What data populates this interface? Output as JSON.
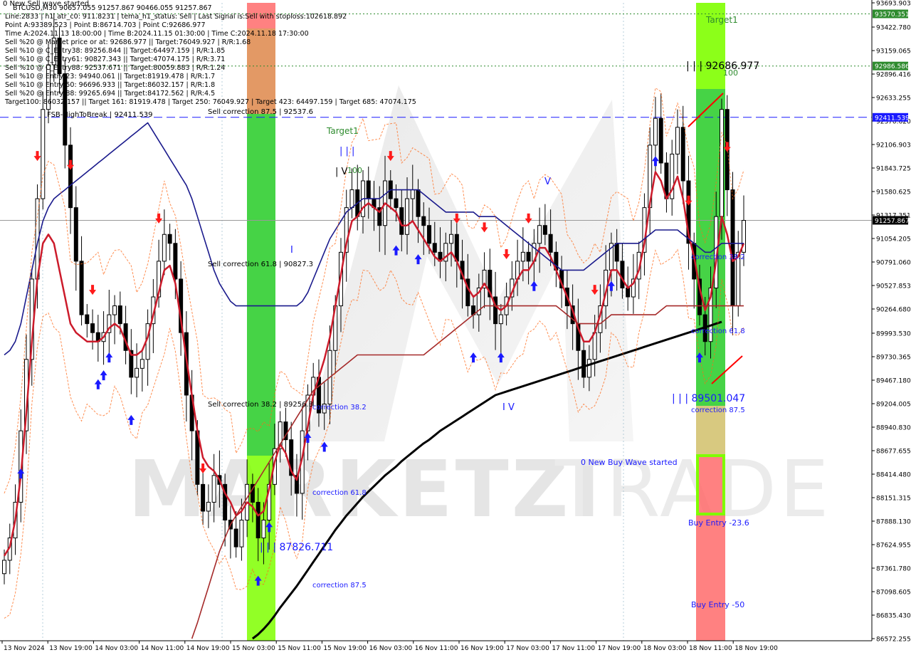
{
  "header": {
    "title": "0 New Sell wave started",
    "lines": [
      "BTCUSD,M30  90657.055 91257.867 90466.055 91257.867",
      "Line:2833 | h1_atr_c0: 911.8231 | tema_h1_status: Sell | Last Signal is:Sell with stoploss:102618.892",
      "Point A:93389.523 | Point B:86714.703 | Point C:92686.977",
      "Time A:2024.11.13 18:00:00 | Time B:2024.11.15 01:30:00 | Time C:2024.11.18 17:30:00",
      "Sell %20 @ Market price or at: 92686.977 || Target:76049.927 | R/R:1.68",
      "Sell %10 @ C_Entry38: 89256.844 || Target:64497.159 | R/R:1.85",
      "Sell %10 @ C_Entry61: 90827.343 || Target:47074.175 | R/R:3.71",
      "Sell %10 @ C_Entry88: 92537.671 || Target:80059.883 | R/R:1.24",
      "Sell %10 @ Entry-23: 94940.061 || Target:81919.478 | R/R:1.7",
      "Sell %10 @ Entry-50: 96696.933 || Target:86032.157 | R/R:1.8",
      "Sell %20 @ Entry-88: 99265.694 || Target:84172.562 | R/R:4.5",
      "Target100: 86032.157 || Target 161: 81919.478 | Target 250: 76049.927 | Target 423: 64497.159 | Target 685: 47074.175"
    ]
  },
  "chart_data": {
    "type": "candlestick",
    "symbol": "BTCUSD",
    "timeframe": "M30",
    "ylim": [
      86572.255,
      93693.903
    ],
    "y_ticks": [
      "93693.903",
      "93422.780",
      "93159.065",
      "92896.416",
      "92633.255",
      "92370.620",
      "92106.903",
      "91843.725",
      "91580.625",
      "91317.351",
      "91054.205",
      "90791.060",
      "90527.853",
      "90264.680",
      "89993.530",
      "89730.365",
      "89467.180",
      "89204.005",
      "88940.830",
      "88677.655",
      "88414.480",
      "88151.315",
      "87888.130",
      "87624.955",
      "87361.780",
      "87098.605",
      "86835.430",
      "86572.255"
    ],
    "x_ticks": [
      "13 Nov 2024",
      "13 Nov 19:00",
      "14 Nov 03:00",
      "14 Nov 11:00",
      "14 Nov 19:00",
      "15 Nov 03:00",
      "15 Nov 11:00",
      "15 Nov 19:00",
      "16 Nov 03:00",
      "16 Nov 11:00",
      "16 Nov 19:00",
      "17 Nov 03:00",
      "17 Nov 11:00",
      "17 Nov 19:00",
      "18 Nov 03:00",
      "18 Nov 11:00",
      "18 Nov 19:00"
    ],
    "current_price": "91257.867",
    "price_lines": [
      {
        "value": 93570.351,
        "label": "93570.351",
        "style": "dotted",
        "color": "#2e8b2e"
      },
      {
        "value": 92986.586,
        "label": "92986.586",
        "style": "dotted",
        "color": "#2e8b2e"
      },
      {
        "value": 92411.539,
        "label": "92411.539",
        "style": "dashed",
        "color": "#1a1aff"
      },
      {
        "value": 91257.867,
        "label": "91257.867",
        "style": "solid",
        "color": "#999999"
      }
    ],
    "annotations": [
      {
        "text": "Target1",
        "color": "#2e8b2e"
      },
      {
        "text": "Target1",
        "color": "#2e8b2e"
      },
      {
        "text": "| | | 92686.977",
        "color": "#000000"
      },
      {
        "text": "100",
        "color": "#2e8b2e"
      },
      {
        "text": "FSB-HighToBreak | 92411.539",
        "color": "#000000"
      },
      {
        "text": "Sell correction 87.5 | 92537.6",
        "color": "#000000"
      },
      {
        "text": "Sell correction 61.8 | 90827.3",
        "color": "#000000"
      },
      {
        "text": "Sell correction 38.2 | 89256.8",
        "color": "#000000"
      },
      {
        "text": "| | |",
        "color": "#1a1aff"
      },
      {
        "text": "| V",
        "color": "#000000"
      },
      {
        "text": "100",
        "color": "#2e8b2e"
      },
      {
        "text": "V",
        "color": "#1a1aff"
      },
      {
        "text": "I V",
        "color": "#1a1aff"
      },
      {
        "text": "I",
        "color": "#1a1aff"
      },
      {
        "text": "correction 38.2",
        "color": "#1a1aff"
      },
      {
        "text": "correction 61.8",
        "color": "#1a1aff"
      },
      {
        "text": "correction 87.5",
        "color": "#1a1aff"
      },
      {
        "text": "| | | 87826.711",
        "color": "#1a1aff"
      },
      {
        "text": "| | | 89501.047",
        "color": "#1a1aff"
      },
      {
        "text": "correction 38.2",
        "color": "#1a1aff"
      },
      {
        "text": "correction 61.8",
        "color": "#1a1aff"
      },
      {
        "text": "correction 87.5",
        "color": "#1a1aff"
      },
      {
        "text": "0 New Buy Wave started",
        "color": "#1a1aff"
      },
      {
        "text": "Buy Entry -23.6",
        "color": "#1a1aff"
      },
      {
        "text": "Buy Entry -50",
        "color": "#1a1aff"
      }
    ],
    "series": [
      {
        "name": "close",
        "color": "#000000",
        "values": [
          87450,
          87700,
          88100,
          88900,
          89700,
          90600,
          91500,
          92500,
          93000,
          93300,
          92900,
          92100,
          91400,
          90800,
          90200,
          90100,
          90000,
          89900,
          90000,
          90200,
          90300,
          90100,
          89800,
          89500,
          89600,
          89700,
          90100,
          90400,
          90800,
          91100,
          91000,
          90600,
          90000,
          89300,
          88900,
          88300,
          88000,
          88100,
          88400,
          88300,
          87900,
          87800,
          87600,
          87900,
          88300,
          88100,
          87700,
          87900,
          88300,
          88700,
          89000,
          88800,
          88400,
          88200,
          88900,
          89300,
          89500,
          89100,
          89200,
          89800,
          90300,
          90900,
          91400,
          91600,
          91300,
          91700,
          91500,
          91400,
          91200,
          91700,
          91500,
          91400,
          91100,
          91500,
          91600,
          91300,
          91200,
          91000,
          90900,
          90800,
          91000,
          91100,
          90800,
          90600,
          90300,
          90200,
          90500,
          90700,
          90400,
          90100,
          90200,
          90400,
          90600,
          90800,
          90900,
          90800,
          91000,
          91200,
          91100,
          90900,
          90700,
          90500,
          90300,
          90100,
          89800,
          89500,
          89700,
          90000,
          90300,
          90700,
          91000,
          90800,
          90500,
          90400,
          90600,
          90900,
          91400,
          92100,
          92400,
          91900,
          91500,
          92000,
          92300,
          91700,
          91000,
          90600,
          90200,
          89900,
          90500,
          91300,
          92500,
          91600,
          90300,
          90900,
          91257
        ]
      },
      {
        "name": "tema",
        "color": "#cc1b2b",
        "values": [
          87500,
          87600,
          87900,
          88400,
          89100,
          89900,
          90600,
          91000,
          91100,
          91000,
          90700,
          90400,
          90100,
          90000,
          89950,
          89900,
          89900,
          89900,
          89950,
          90050,
          90100,
          90050,
          89900,
          89750,
          89750,
          89800,
          89950,
          90200,
          90450,
          90700,
          90750,
          90550,
          90150,
          89700,
          89300,
          88900,
          88600,
          88500,
          88450,
          88350,
          88200,
          88100,
          87950,
          88000,
          88100,
          88050,
          87950,
          88000,
          88250,
          88550,
          88750,
          88650,
          88450,
          88350,
          88600,
          88950,
          89300,
          89500,
          89700,
          89950,
          90300,
          90650,
          91000,
          91250,
          91300,
          91400,
          91450,
          91400,
          91350,
          91450,
          91400,
          91350,
          91200,
          91200,
          91250,
          91150,
          91050,
          90950,
          90850,
          90800,
          90850,
          90900,
          90800,
          90650,
          90500,
          90400,
          90450,
          90550,
          90450,
          90300,
          90250,
          90300,
          90450,
          90600,
          90700,
          90700,
          90800,
          90950,
          90950,
          90850,
          90700,
          90550,
          90400,
          90250,
          90050,
          89900,
          89900,
          90000,
          90200,
          90450,
          90700,
          90700,
          90600,
          90500,
          90550,
          90700,
          91000,
          91450,
          91800,
          91700,
          91500,
          91600,
          91750,
          91500,
          91100,
          90850,
          90500,
          90250,
          90400,
          90800,
          91300,
          91100,
          90800,
          90850,
          91000
        ]
      },
      {
        "name": "ma_slow",
        "color": "#1a1a8c",
        "values": [
          89750,
          89800,
          89900,
          90100,
          90400,
          90700,
          91000,
          91250,
          91400,
          91500,
          91550,
          91600,
          91650,
          91700,
          91750,
          91800,
          91850,
          91900,
          91950,
          92000,
          92050,
          92100,
          92150,
          92200,
          92250,
          92300,
          92350,
          92250,
          92150,
          92050,
          91950,
          91850,
          91750,
          91650,
          91500,
          91300,
          91100,
          90900,
          90700,
          90550,
          90450,
          90350,
          90300,
          90300,
          90300,
          90300,
          90300,
          90300,
          90300,
          90300,
          90300,
          90300,
          90300,
          90300,
          90350,
          90450,
          90600,
          90750,
          90900,
          91050,
          91150,
          91250,
          91350,
          91400,
          91450,
          91500,
          91500,
          91500,
          91500,
          91550,
          91600,
          91600,
          91600,
          91600,
          91600,
          91600,
          91550,
          91500,
          91450,
          91400,
          91350,
          91350,
          91350,
          91350,
          91350,
          91350,
          91300,
          91300,
          91300,
          91300,
          91250,
          91200,
          91150,
          91100,
          91050,
          91000,
          90950,
          90900,
          90850,
          90800,
          90750,
          90700,
          90700,
          90700,
          90700,
          90700,
          90750,
          90800,
          90850,
          90900,
          90950,
          91000,
          91000,
          91000,
          91000,
          91000,
          91050,
          91100,
          91150,
          91150,
          91150,
          91150,
          91150,
          91100,
          91050,
          91000,
          90950,
          90900,
          90900,
          90950,
          91000,
          91000,
          91000,
          91000,
          91000
        ]
      },
      {
        "name": "ma_mid",
        "color": "#a52a2a",
        "values": [
          null,
          null,
          null,
          null,
          null,
          null,
          null,
          null,
          null,
          null,
          null,
          null,
          null,
          null,
          null,
          null,
          null,
          null,
          null,
          null,
          null,
          null,
          null,
          null,
          null,
          null,
          null,
          null,
          null,
          null,
          null,
          null,
          null,
          null,
          86572,
          86750,
          86950,
          87150,
          87350,
          87550,
          87700,
          87850,
          87950,
          88050,
          88150,
          88250,
          88350,
          88450,
          88550,
          88650,
          88750,
          88850,
          88950,
          89050,
          89150,
          89250,
          89350,
          89400,
          89450,
          89500,
          89550,
          89600,
          89650,
          89700,
          89750,
          89750,
          89750,
          89750,
          89750,
          89750,
          89750,
          89750,
          89750,
          89750,
          89750,
          89750,
          89750,
          89800,
          89850,
          89900,
          89950,
          90000,
          90050,
          90100,
          90150,
          90200,
          90250,
          90300,
          90300,
          90300,
          90300,
          90300,
          90300,
          90300,
          90300,
          90300,
          90300,
          90300,
          90300,
          90300,
          90300,
          90250,
          90200,
          90150,
          90100,
          90100,
          90100,
          90100,
          90100,
          90150,
          90200,
          90200,
          90200,
          90200,
          90200,
          90200,
          90200,
          90200,
          90200,
          90250,
          90300,
          90300,
          90300,
          90300,
          90300,
          90300,
          90300,
          90300,
          90300,
          90300,
          90300,
          90300,
          90300,
          90300,
          90300
        ]
      },
      {
        "name": "ma_long",
        "color": "#000000",
        "values": [
          null,
          null,
          null,
          null,
          null,
          null,
          null,
          null,
          null,
          null,
          null,
          null,
          null,
          null,
          null,
          null,
          null,
          null,
          null,
          null,
          null,
          null,
          null,
          null,
          null,
          null,
          null,
          null,
          null,
          null,
          null,
          null,
          null,
          null,
          null,
          null,
          null,
          null,
          null,
          null,
          null,
          null,
          null,
          null,
          null,
          86572,
          86620,
          86680,
          86750,
          86830,
          86920,
          87000,
          87080,
          87160,
          87250,
          87340,
          87430,
          87520,
          87610,
          87700,
          87790,
          87870,
          87950,
          88020,
          88090,
          88160,
          88220,
          88280,
          88340,
          88400,
          88450,
          88500,
          88560,
          88610,
          88660,
          88710,
          88760,
          88800,
          88850,
          88900,
          88940,
          88980,
          89020,
          89060,
          89100,
          89140,
          89180,
          89220,
          89260,
          89300,
          89320,
          89340,
          89360,
          89380,
          89400,
          89420,
          89440,
          89460,
          89480,
          89500,
          89520,
          89540,
          89560,
          89580,
          89600,
          89620,
          89640,
          89660,
          89680,
          89700,
          89720,
          89740,
          89760,
          89780,
          89800,
          89820,
          89840,
          89860,
          89880,
          89900,
          89920,
          89940,
          89960,
          89980,
          90000,
          90020,
          90040,
          90060,
          90080,
          90100,
          90120
        ]
      }
    ],
    "arrows": {
      "buy": [
        3,
        17,
        18,
        19,
        23,
        46,
        48,
        55,
        58,
        71,
        75,
        85,
        90,
        96,
        110,
        118,
        126
      ],
      "sell": [
        6,
        12,
        16,
        28,
        36,
        70,
        82,
        87,
        91,
        95,
        107,
        124,
        131
      ]
    },
    "zones": [
      {
        "name": "sell zone 1",
        "color": "#ff6b6b"
      },
      {
        "name": "buy zone 1",
        "color": "#3cd13c"
      },
      {
        "name": "buy zone 1 top",
        "color": "#7fff00"
      },
      {
        "name": "sell zone 2",
        "color": "#ff6b6b"
      },
      {
        "name": "buy zone 2",
        "color": "#3cd13c"
      },
      {
        "name": "buy zone 2 top",
        "color": "#7fff00"
      }
    ]
  }
}
